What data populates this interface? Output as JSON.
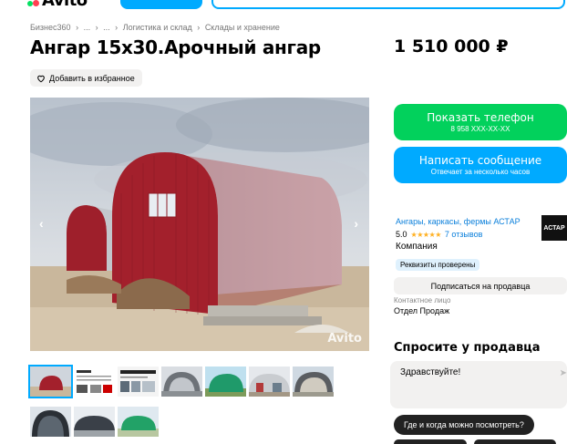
{
  "header": {
    "logo_text": "Avito"
  },
  "breadcrumb": [
    "Бизнес360",
    "›",
    "...",
    "›",
    "...",
    "›",
    "Логистика и склад",
    "›",
    "Склады и хранение"
  ],
  "listing": {
    "title": "Ангар 15x30.Арочный ангар",
    "price": "1 510 000 ₽",
    "favorite_label": "Добавить в избранное",
    "photo_watermark": "Avito",
    "prev_arrow": "‹",
    "next_arrow": "›"
  },
  "actions": {
    "show_phone_label": "Показать телефон",
    "phone_masked": "8 958 XXX-XX-XX",
    "write_message_label": "Написать сообщение",
    "write_message_sub": "Отвечает за несколько часов"
  },
  "seller": {
    "name": "Ангары, каркасы, фермы АСТАР",
    "logo_text": "АСТАР",
    "rating": "5.0",
    "stars": "★★★★★",
    "reviews": "7 отзывов",
    "type": "Компания",
    "verified_badge": "Реквизиты проверены",
    "subscribe_label": "Подписаться на продавца",
    "contact_label": "Контактное лицо",
    "contact_name": "Отдел Продаж"
  },
  "ask": {
    "title": "Спросите у продавца",
    "message": "Здравствуйте!",
    "quick_question": "Где и когда можно посмотреть?"
  },
  "colors": {
    "green": "#02d15c",
    "blue": "#00aaff",
    "link": "#0a7fdb",
    "star": "#ffb021"
  }
}
